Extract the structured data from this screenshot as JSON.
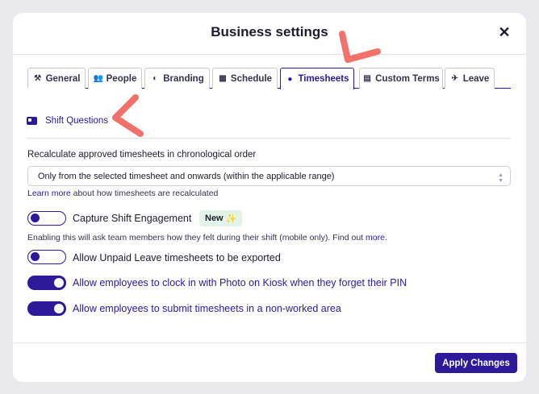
{
  "modal": {
    "title": "Business settings",
    "close_symbol": "✕"
  },
  "tabs": [
    {
      "label": "General",
      "icon": "tools-icon",
      "glyph": "⚒"
    },
    {
      "label": "People",
      "icon": "people-icon",
      "glyph": "👥"
    },
    {
      "label": "Branding",
      "icon": "palette-icon",
      "glyph": "◐"
    },
    {
      "label": "Schedule",
      "icon": "calendar-icon",
      "glyph": "▦"
    },
    {
      "label": "Timesheets",
      "icon": "clock-icon",
      "glyph": "●",
      "active": true
    },
    {
      "label": "Custom Terms",
      "icon": "book-icon",
      "glyph": "▤"
    },
    {
      "label": "Leave",
      "icon": "plane-icon",
      "glyph": "✈"
    }
  ],
  "subtab": {
    "label": "Shift Questions",
    "icon": "id-card-icon"
  },
  "recalc": {
    "label": "Recalculate approved timesheets in chronological order",
    "selected": "Only from the selected timesheet and onwards (within the applicable range)",
    "learn_more_link": "Learn more",
    "learn_more_rest": " about how timesheets are recalculated"
  },
  "toggles": [
    {
      "label": "Capture Shift Engagement",
      "on": false
    },
    {
      "label": "Allow Unpaid Leave timesheets to be exported",
      "on": false
    },
    {
      "label": "Allow employees to clock in with Photo on Kiosk when they forget their PIN",
      "on": true
    },
    {
      "label": "Allow employees to submit timesheets in a non-worked area",
      "on": true
    }
  ],
  "badge": {
    "label": "New",
    "sparkle": "✨"
  },
  "engagement_help": {
    "text": "Enabling this will ask team members how they felt during their shift (mobile only). Find out ",
    "link": "more."
  },
  "footer": {
    "apply_label": "Apply Changes"
  },
  "colors": {
    "accent": "#2b1b9a",
    "annotation": "#f2716b",
    "badge_bg": "#e4f3e9"
  }
}
